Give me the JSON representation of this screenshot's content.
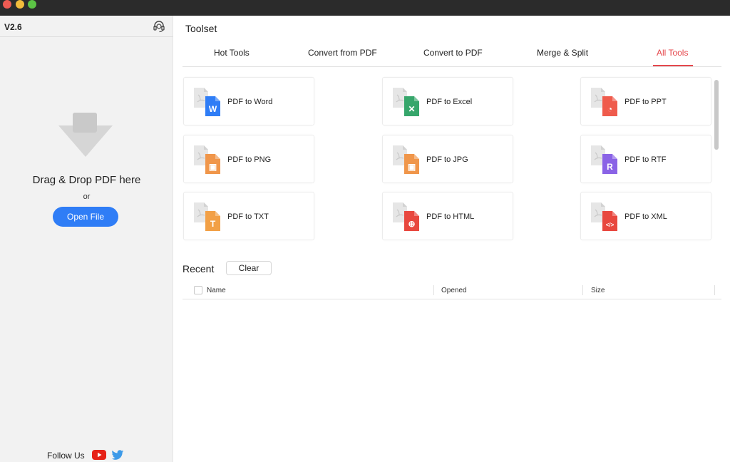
{
  "window": {
    "controls": [
      "close",
      "minimize",
      "zoom"
    ]
  },
  "sidebar": {
    "version": "V2.6",
    "support_icon": "support-agent-icon",
    "drop_icon": "download-arrow-icon",
    "drag_text": "Drag & Drop PDF here",
    "or_text": "or",
    "open_button": "Open File",
    "follow_text": "Follow Us",
    "social_icons": [
      "youtube-icon",
      "twitter-icon"
    ]
  },
  "main": {
    "title": "Toolset",
    "tabs": [
      {
        "label": "Hot Tools"
      },
      {
        "label": "Convert from PDF"
      },
      {
        "label": "Convert to PDF"
      },
      {
        "label": "Merge & Split"
      },
      {
        "label": "All Tools",
        "active": true
      }
    ],
    "tools": [
      {
        "label": "PDF to Word",
        "icon": "word-doc-icon",
        "glyph": "W",
        "color": "#2f7df6"
      },
      {
        "label": "PDF to Excel",
        "icon": "excel-doc-icon",
        "glyph": "✕",
        "color": "#36a66b"
      },
      {
        "label": "PDF to PPT",
        "icon": "ppt-doc-icon",
        "glyph": "◔",
        "color": "#ef5b4c"
      },
      {
        "label": "PDF to PNG",
        "icon": "png-image-icon",
        "glyph": "▣",
        "color": "#f0964a"
      },
      {
        "label": "PDF to JPG",
        "icon": "jpg-image-icon",
        "glyph": "▣",
        "color": "#f0964a"
      },
      {
        "label": "PDF to RTF",
        "icon": "rtf-doc-icon",
        "glyph": "R",
        "color": "#8a63e6"
      },
      {
        "label": "PDF to TXT",
        "icon": "txt-doc-icon",
        "glyph": "T",
        "color": "#f2a046"
      },
      {
        "label": "PDF to HTML",
        "icon": "html-globe-icon",
        "glyph": "⊕",
        "color": "#e8483f"
      },
      {
        "label": "PDF to XML",
        "icon": "xml-code-icon",
        "glyph": "</>",
        "color": "#e8483f"
      }
    ],
    "recent": {
      "title": "Recent",
      "clear_label": "Clear",
      "columns": {
        "name": "Name",
        "opened": "Opened",
        "size": "Size"
      }
    }
  }
}
